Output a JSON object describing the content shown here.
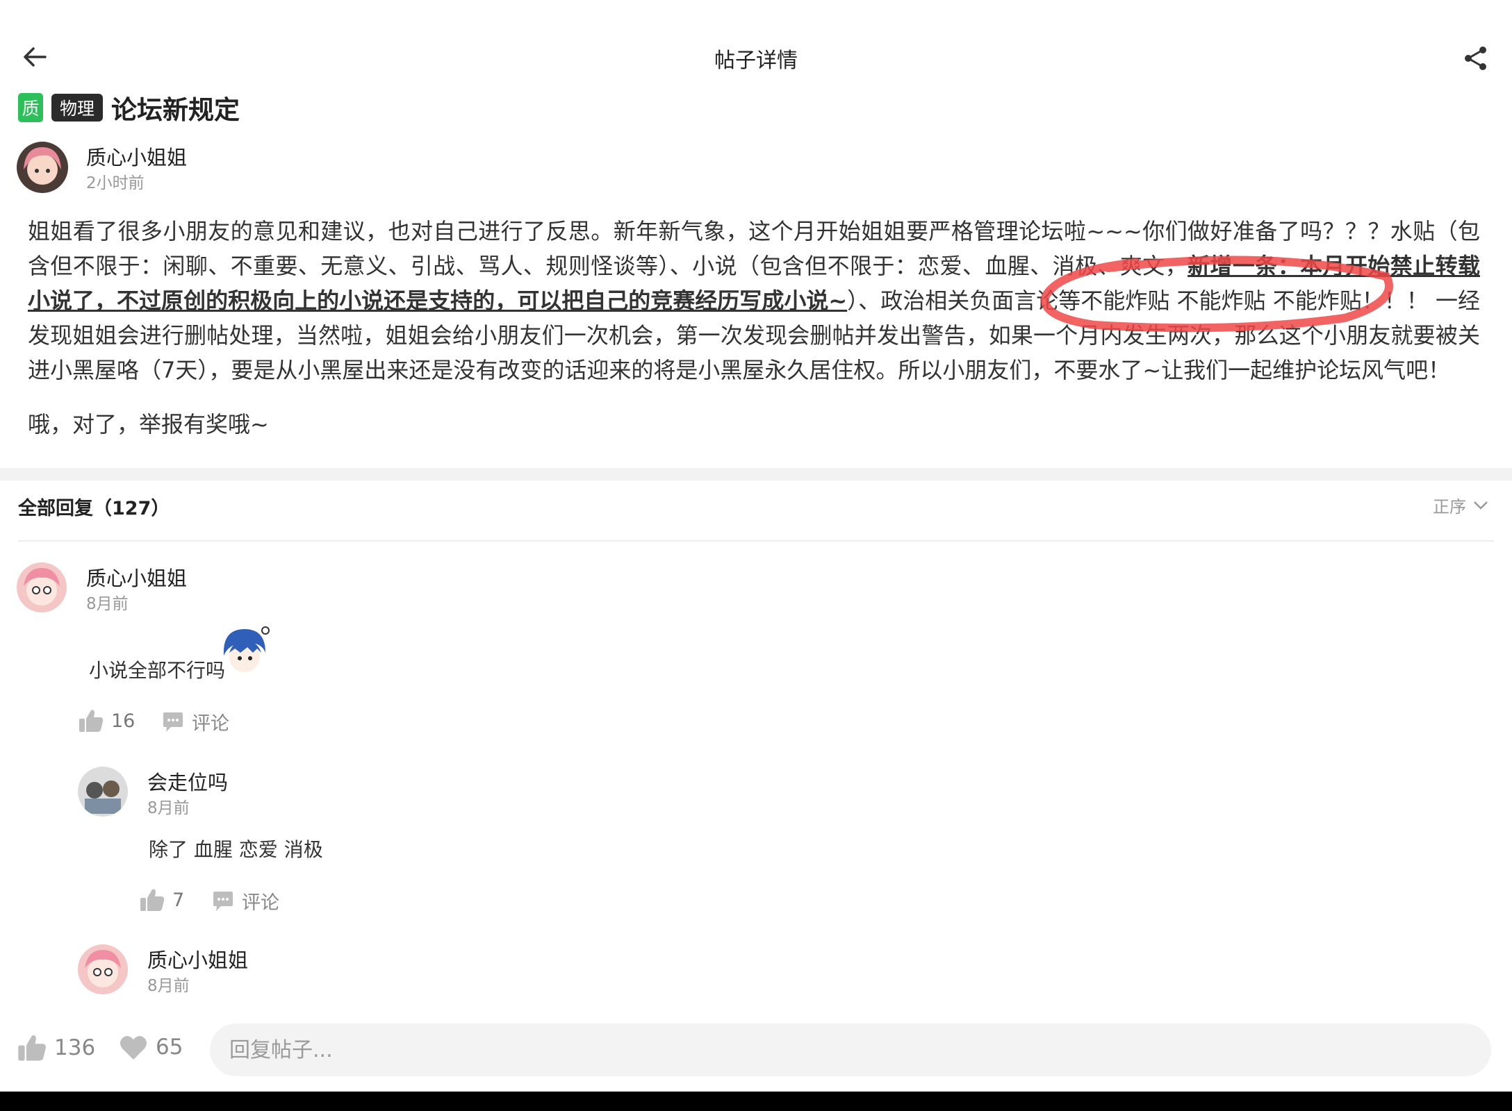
{
  "header": {
    "title": "帖子详情"
  },
  "post": {
    "badge_quality": "质",
    "badge_subject": "物理",
    "title": "论坛新规定",
    "author": "质心小姐姐",
    "time": "2小时前",
    "body_part1": "姐姐看了很多小朋友的意见和建议，也对自己进行了反思。新年新气象，这个月开始姐姐要严格管理论坛啦~~~你们做好准备了吗？？？水贴（包含但不限于：闲聊、不重要、无意义、引战、骂人、规则怪谈等）、小说（包含但不限于：恋爱、血腥、消极、爽文，",
    "body_highlight": "新增一条：本月开始禁止转载小说了，不过原创的积极向上的小说还是支持的，可以把自己的竞赛经历写成小说~",
    "body_part2": "）、政治相关负面言论等不能炸贴 不能炸贴 不能炸贴！！！ 一经发现姐姐会进行删帖处理，当然啦，姐姐会给小朋友们一次机会，第一次发现会删帖并发出警告，如果一个月内发生两次，那么这个小朋友就要被关进小黑屋咯（7天），要是从小黑屋出来还是没有改变的话迎来的将是小黑屋永久居住权。所以小朋友们，不要水了~让我们一起维护论坛风气吧！",
    "body_tail": "哦，对了，举报有奖哦~"
  },
  "replies": {
    "header": "全部回复（127）",
    "sort_label": "正序",
    "items": [
      {
        "author": "质心小姐姐",
        "time": "8月前",
        "text": "小说全部不行吗",
        "likes": "16",
        "comment_label": "评论"
      },
      {
        "author": "会走位吗",
        "time": "8月前",
        "text": "除了 血腥 恋爱 消极",
        "likes": "7",
        "comment_label": "评论"
      },
      {
        "author": "质心小姐姐",
        "time": "8月前"
      }
    ]
  },
  "bottom": {
    "likes": "136",
    "favorites": "65",
    "reply_placeholder": "回复帖子..."
  },
  "colors": {
    "quality_badge": "#2dbf59",
    "subject_badge": "#2b2b2b",
    "annotation": "#f04848",
    "icon_gray": "#c4c4c4"
  },
  "icons": [
    "back-arrow-icon",
    "share-icon",
    "thumbs-up-icon",
    "comment-icon",
    "heart-icon",
    "chevron-down-icon"
  ]
}
